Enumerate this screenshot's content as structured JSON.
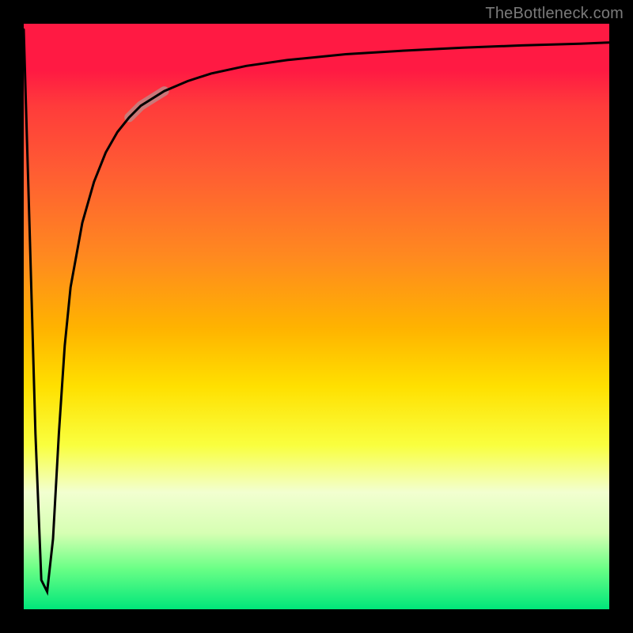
{
  "attribution": "TheBottleneck.com",
  "colors": {
    "frame": "#000000",
    "curve": "#000000",
    "highlight": "#bb8b8b",
    "gradient_stops": [
      "#ff1a43",
      "#ff3b3b",
      "#ff5c33",
      "#ff8a1f",
      "#ffb300",
      "#ffe000",
      "#f9ff3f",
      "#f2ffd0",
      "#d6ffb3",
      "#6bff86",
      "#00e67a"
    ]
  },
  "chart_data": {
    "type": "line",
    "title": "",
    "xlabel": "",
    "ylabel": "",
    "xlim": [
      0,
      100
    ],
    "ylim": [
      0,
      100
    ],
    "x": [
      0,
      1,
      2,
      3,
      4,
      5,
      6,
      7,
      8,
      10,
      12,
      14,
      16,
      18,
      20,
      24,
      28,
      32,
      38,
      45,
      55,
      65,
      75,
      85,
      95,
      100
    ],
    "values": [
      99,
      65,
      30,
      5,
      3,
      12,
      30,
      45,
      55,
      66,
      73,
      78,
      81.5,
      84,
      86,
      88.5,
      90.2,
      91.5,
      92.8,
      93.8,
      94.8,
      95.4,
      95.9,
      96.3,
      96.6,
      96.8
    ],
    "highlight_range_x": [
      18,
      26
    ],
    "notes": "Single dark curve over vertical rainbow gradient; no axis ticks visible. Values estimated as percent of plot height (0 bottom, 100 top)."
  }
}
